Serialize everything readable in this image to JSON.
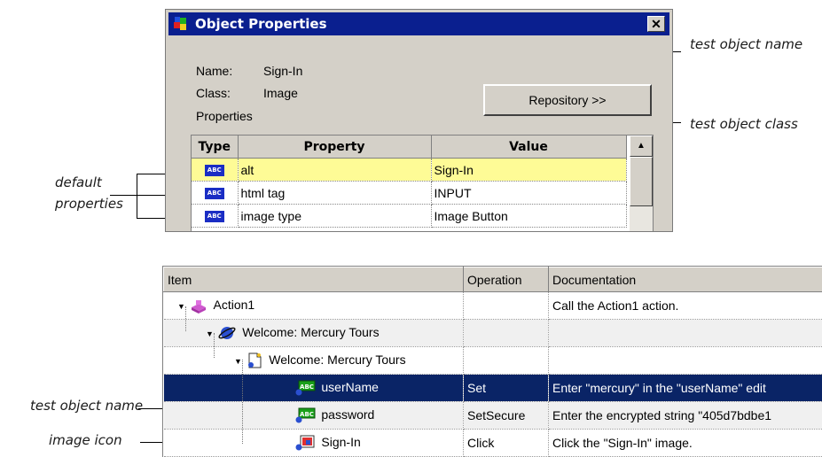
{
  "callouts": {
    "test_object_name_top": "test object name",
    "test_object_class": "test object class",
    "default_properties_line1": "default",
    "default_properties_line2": "properties",
    "test_object_name_bottom": "test object name",
    "image_icon": "image icon"
  },
  "dialog": {
    "title": "Object Properties",
    "close": "✕",
    "name_label": "Name:",
    "name_value": "Sign-In",
    "class_label": "Class:",
    "class_value": "Image",
    "properties_label": "Properties",
    "repository_button": "Repository >>",
    "columns": [
      "Type",
      "Property",
      "Value"
    ],
    "type_icon_text": "ABC",
    "rows": [
      {
        "property": "alt",
        "value": "Sign-In"
      },
      {
        "property": "html tag",
        "value": "INPUT"
      },
      {
        "property": "image type",
        "value": "Image Button"
      }
    ],
    "scroll_up": "▲"
  },
  "keyword_view": {
    "columns": [
      "Item",
      "Operation",
      "Documentation"
    ],
    "rows": [
      {
        "item": "Action1",
        "operation": "",
        "documentation": "Call the Action1 action.",
        "icon": "action-icon"
      },
      {
        "item": "Welcome: Mercury Tours",
        "operation": "",
        "documentation": "",
        "icon": "browser-icon"
      },
      {
        "item": "Welcome: Mercury Tours",
        "operation": "",
        "documentation": "",
        "icon": "page-icon"
      },
      {
        "item": "userName",
        "operation": "Set",
        "documentation": "Enter \"mercury\" in the \"userName\" edit",
        "icon": "edit-field-icon"
      },
      {
        "item": "password",
        "operation": "SetSecure",
        "documentation": "Enter the encrypted string \"405d7bdbe1",
        "icon": "edit-field-icon"
      },
      {
        "item": "Sign-In",
        "operation": "Click",
        "documentation": "Click the \"Sign-In\" image.",
        "icon": "image-icon"
      }
    ]
  },
  "colors": {
    "titlebar": "#0a1f8f",
    "selected_row_dialog": "#fefb96",
    "selected_row_grid": "#0a2466"
  }
}
